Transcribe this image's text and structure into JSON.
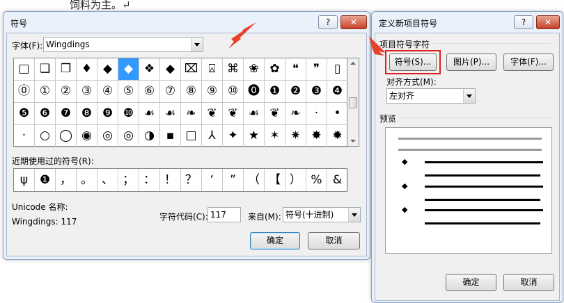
{
  "doc": {
    "text": "饲料为主。↵"
  },
  "symbol_dialog": {
    "title": "符号",
    "help_label": "?",
    "close_label": "✕",
    "font_label": "字体(F):",
    "font_value": "Wingdings",
    "grid": [
      [
        "□",
        "❏",
        "❐",
        "♦",
        "◆",
        "◆",
        "❖",
        "◆",
        "⌧",
        "⍓",
        "⌘",
        "❀",
        "✿",
        "❝",
        "❞",
        "▯"
      ],
      [
        "⓪",
        "①",
        "②",
        "③",
        "④",
        "⑤",
        "⑥",
        "⑦",
        "⑧",
        "⑨",
        "⑩",
        "⓿",
        "❶",
        "❷",
        "❸",
        "❹"
      ],
      [
        "❺",
        "❻",
        "❼",
        "❽",
        "❾",
        "❿",
        "☙",
        "☙",
        "❧",
        "❦",
        "❦",
        "☙",
        "❦",
        "❧",
        "·",
        "•"
      ],
      [
        "·",
        "○",
        "◯",
        "◉",
        "◎",
        "◎",
        "◑",
        "▪",
        "□",
        "⅄",
        "✦",
        "★",
        "✶",
        "✷",
        "✸",
        "✹"
      ]
    ],
    "recent_label": "近期使用过的符号(R):",
    "recent": [
      "ψ",
      "❶",
      "，",
      "。",
      "、",
      "；",
      "：",
      "！",
      "？",
      "‘",
      "”",
      "（",
      "【",
      "）",
      "%",
      "&"
    ],
    "unicode_name_label": "Unicode 名称:",
    "unicode_name_value": "Wingdings: 117",
    "char_code_label": "字符代码(C):",
    "char_code_value": "117",
    "from_label": "来自(M):",
    "from_value": "符号(十进制)",
    "ok_label": "确定",
    "cancel_label": "取消"
  },
  "bullet_dialog": {
    "title": "定义新项目符号",
    "help_label": "?",
    "close_label": "✕",
    "group_label": "项目符号字符",
    "symbol_button": "符号(S)...",
    "picture_button": "图片(P)...",
    "font_button": "字体(F)...",
    "align_label": "对齐方式(M):",
    "align_value": "左对齐",
    "preview_label": "预览",
    "preview_bullet": "◆",
    "ok_label": "确定",
    "cancel_label": "取消"
  },
  "colors": {
    "highlight": "#3399ff",
    "annotation": "#e02020"
  }
}
